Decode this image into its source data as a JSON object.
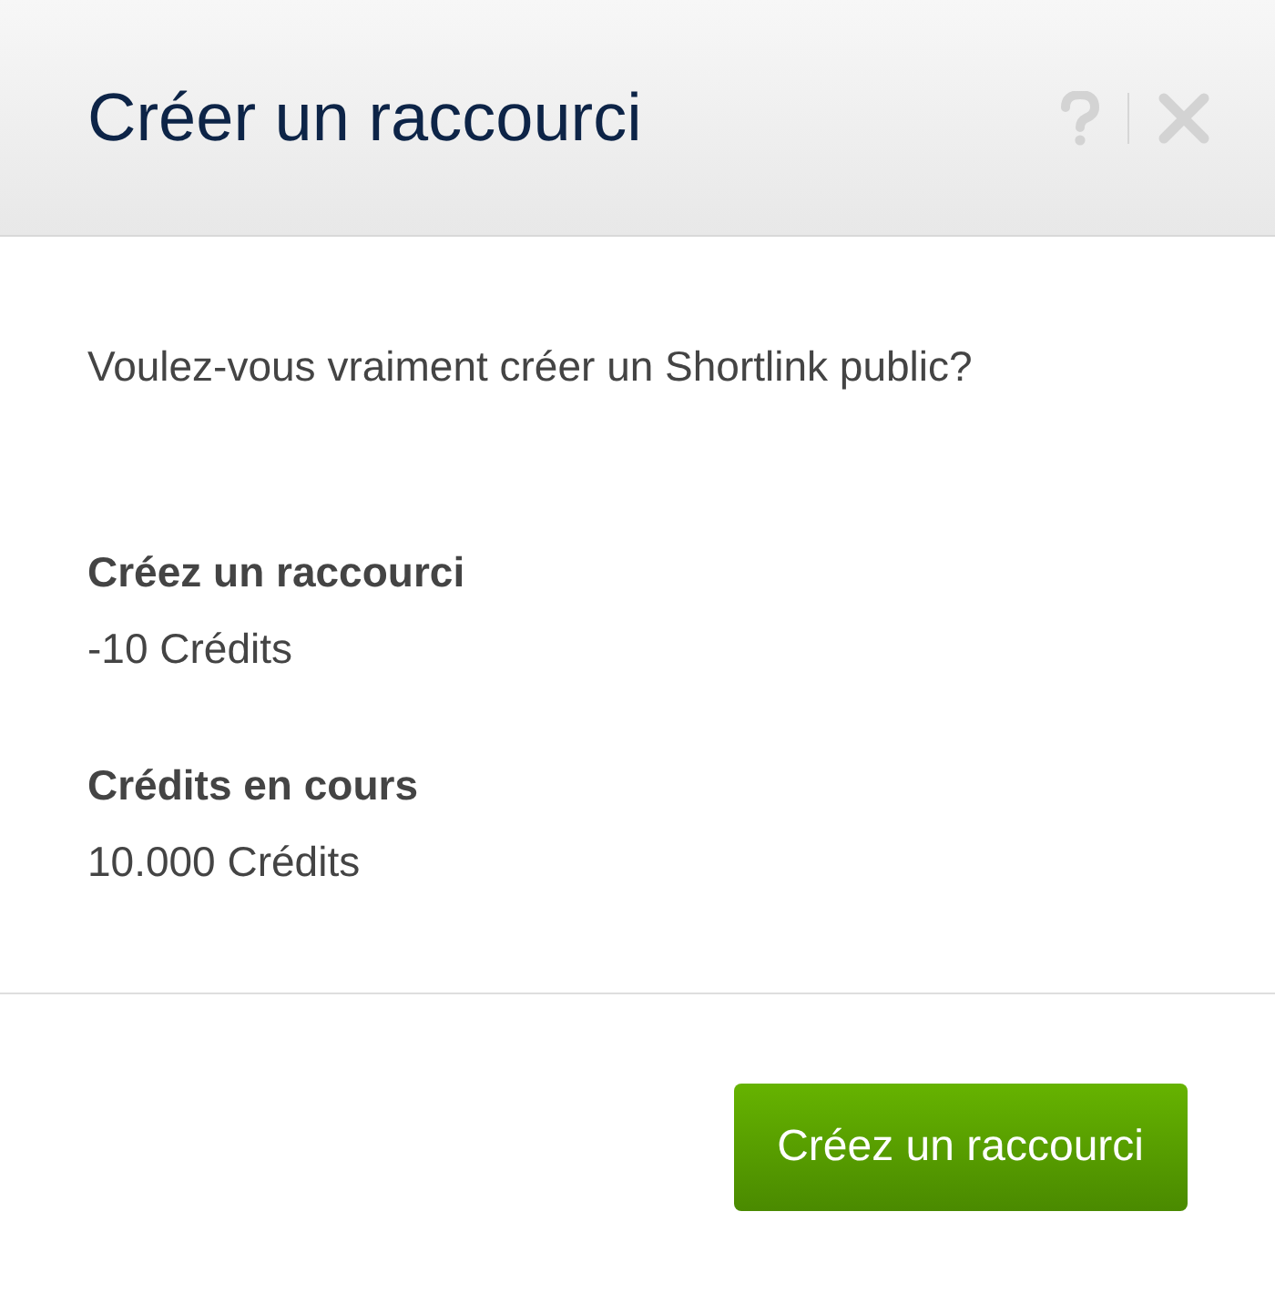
{
  "dialog": {
    "title": "Créer un raccourci"
  },
  "message": "Voulez-vous vraiment créer un Shortlink public?",
  "details": [
    {
      "label": "Créez un raccourci",
      "value": "-10 Crédits"
    },
    {
      "label": "Crédits en cours",
      "value": "10.000 Crédits"
    }
  ],
  "buttons": [
    "Créez un raccourci"
  ]
}
